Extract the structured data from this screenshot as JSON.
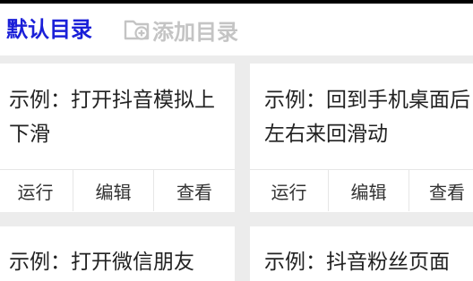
{
  "tabs": {
    "default_label": "默认目录",
    "add_label": "添加目录"
  },
  "cards": [
    {
      "title": "示例：打开抖音模拟上下滑",
      "actions": [
        "运行",
        "编辑",
        "查看"
      ]
    },
    {
      "title": "示例：回到手机桌面后左右来回滑动",
      "actions": [
        "运行",
        "编辑",
        "查看"
      ]
    },
    {
      "title": "示例：打开微信朋友",
      "actions": []
    },
    {
      "title": "示例：抖音粉丝页面",
      "actions": []
    }
  ],
  "colors": {
    "accent": "#1a1fd8",
    "disabled": "#c4c4c4",
    "background": "#ececec",
    "card": "#ffffff",
    "text": "#222222"
  },
  "icons": {
    "add_folder": "folder-plus-icon"
  }
}
